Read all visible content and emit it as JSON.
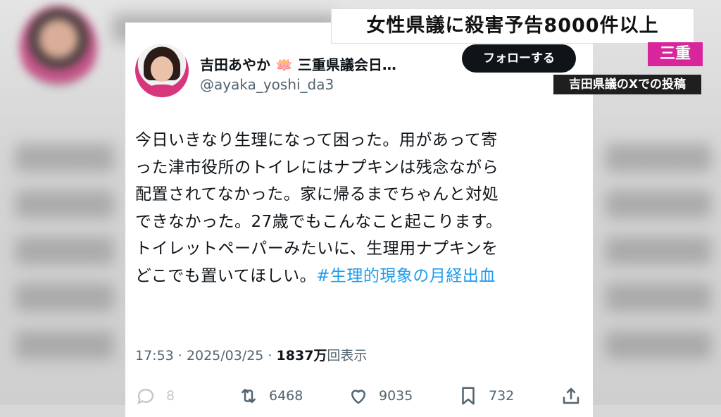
{
  "headline": "女性県議に殺害予告8000件以上",
  "region_label": "三重",
  "source_label": "吉田県議のXでの投稿",
  "tweet": {
    "display_name": "吉田あやか",
    "name_suffix": "三重県議会日…",
    "handle": "@ayaka_yoshi_da3",
    "follow_label": "フォローする",
    "body_lines": [
      "今日いきなり生理になって困った。用があって寄",
      "った津市役所のトイレにはナプキンは残念ながら",
      "配置されてなかった。家に帰るまでちゃんと対処",
      "できなかった。27歳でもこんなこと起こります。",
      "トイレットペーパーみたいに、生理用ナプキンを",
      "どこでも置いてほしい。"
    ],
    "hashtag": "#生理的現象の月経出血",
    "time": "17:53",
    "date": "2025/03/25",
    "views_count": "1837万",
    "views_suffix": "回表示",
    "reply_count": "8",
    "retweet_count": "6468",
    "like_count": "9035",
    "bookmark_count": "732"
  },
  "colors": {
    "accent_link": "#1d9bf0",
    "region_badge": "#d9259b",
    "follow_button": "#0f1419"
  },
  "icons": [
    "lotus-emoji-icon",
    "reply-icon",
    "retweet-icon",
    "heart-icon",
    "bookmark-icon",
    "share-icon"
  ]
}
